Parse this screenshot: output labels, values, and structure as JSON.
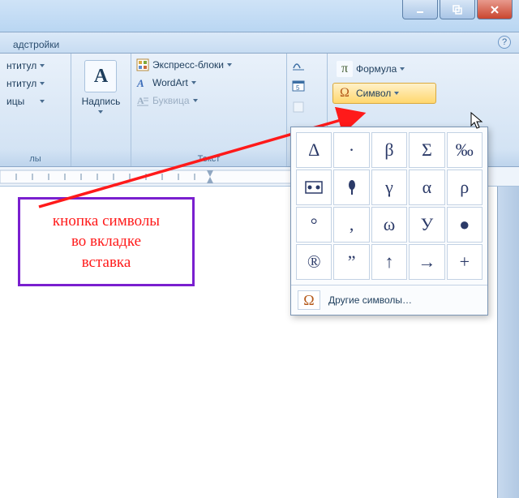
{
  "tabs": {
    "addins": "адстройки"
  },
  "ribbon": {
    "group1": {
      "item1": "нтитул",
      "item2": "нтитул",
      "item3": "ицы",
      "label": "лы"
    },
    "group2": {
      "button": "Надпись"
    },
    "group3": {
      "quickparts": "Экспресс-блоки",
      "wordart": "WordArt",
      "dropcap": "Буквица",
      "label": "Текст"
    },
    "group5": {
      "equation": "Формула",
      "symbol": "Символ"
    }
  },
  "symbol_panel": {
    "grid": [
      "Δ",
      "·",
      "β",
      "Σ",
      "‰",
      "▣",
      "◆",
      "γ",
      "α",
      "ρ",
      "°",
      ",",
      "ω",
      "У",
      "●",
      "®",
      "”",
      "↑",
      "→",
      "+"
    ],
    "more": "Другие символы…"
  },
  "callout": {
    "line1": "кнопка символы",
    "line2": "во вкладке",
    "line3": "вставка"
  }
}
